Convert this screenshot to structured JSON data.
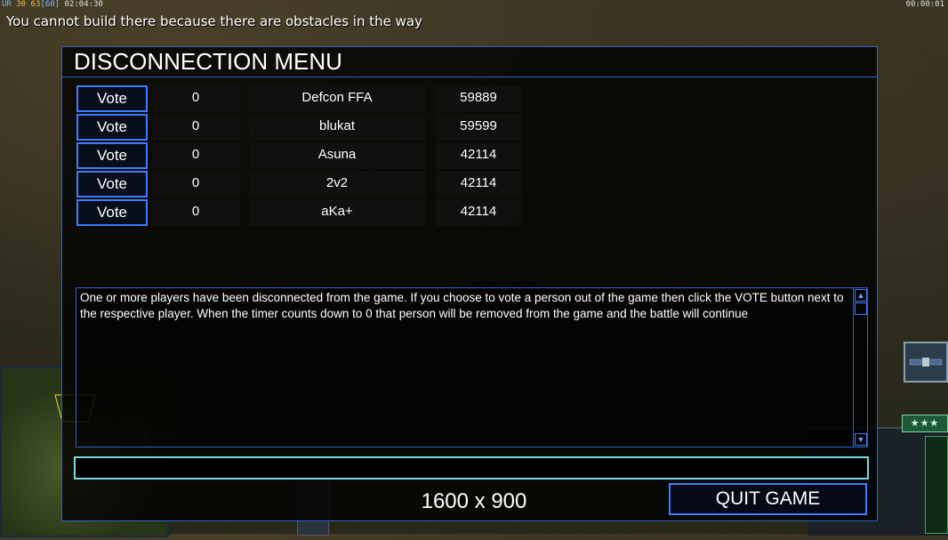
{
  "hud": {
    "prefix": "UR",
    "stat1": "30",
    "stat2": "63",
    "stat3": "[60]",
    "elapsed": "02:04:30",
    "clock": "00:00:01"
  },
  "warning": "You cannot build there because there are obstacles in the way",
  "menu": {
    "title": "DISCONNECTION MENU",
    "vote_label": "Vote",
    "players": [
      {
        "count": "0",
        "name": "Defcon FFA",
        "ping": "59889"
      },
      {
        "count": "0",
        "name": "blukat",
        "ping": "59599"
      },
      {
        "count": "0",
        "name": "Asuna",
        "ping": "42114"
      },
      {
        "count": "0",
        "name": "2v2",
        "ping": "42114"
      },
      {
        "count": "0",
        "name": "aKa+",
        "ping": "42114"
      }
    ],
    "message": "One or more players have been disconnected from the game. If you choose to vote a person out of the game then click the VOTE button next to the respective player. When the timer counts down to 0 that person will be removed from the game and the battle will continue",
    "chat_value": "",
    "resolution": "1600 x 900",
    "quit_label": "QUIT GAME"
  },
  "side": {
    "rank_stars": "★★★"
  },
  "icons": {
    "scroll_up": "▲",
    "scroll_down": "▼"
  }
}
